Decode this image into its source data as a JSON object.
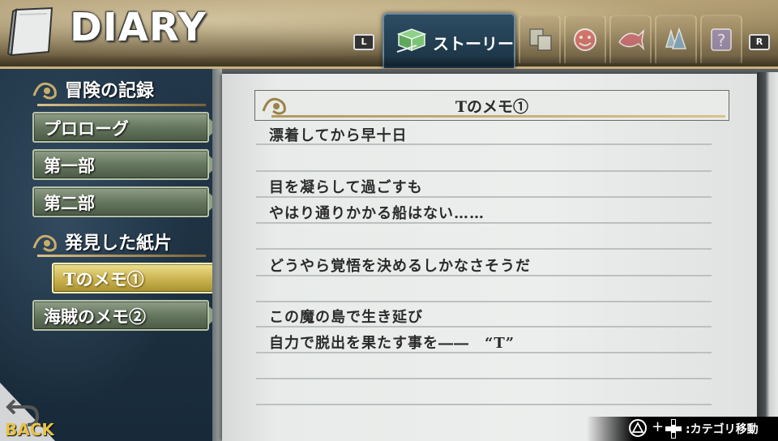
{
  "header": {
    "title": "DIARY",
    "shoulder_left": "L",
    "shoulder_right": "R",
    "active_tab": {
      "label": "ストーリー",
      "icon": "open-book-icon"
    },
    "other_tabs": [
      {
        "icon": "notes-icon"
      },
      {
        "icon": "face-icon"
      },
      {
        "icon": "fish-icon"
      },
      {
        "icon": "crystal-icon"
      },
      {
        "icon": "question-icon"
      }
    ]
  },
  "sidebar": {
    "sections": [
      {
        "title": "冒険の記録",
        "items": [
          {
            "label": "プロローグ",
            "selected": false
          },
          {
            "label": "第一部",
            "selected": false
          },
          {
            "label": "第二部",
            "selected": false
          }
        ]
      },
      {
        "title": "発見した紙片",
        "items": [
          {
            "label": "Tのメモ①",
            "selected": true
          },
          {
            "label": "海賊のメモ②",
            "selected": false
          }
        ]
      }
    ],
    "back_label": "BACK"
  },
  "memo": {
    "title": "Tのメモ①",
    "lines": [
      "漂着してから早十日",
      "",
      "目を凝らして過ごすも",
      "やはり通りかかる船はない……",
      "",
      "どうやら覚悟を決めるしかなさそうだ",
      "",
      "この魔の島で生き延び",
      "自力で脱出を果たす事を――　“T”",
      "",
      ""
    ]
  },
  "hint": {
    "plus": "+",
    "text": ":カテゴリ移動"
  }
}
